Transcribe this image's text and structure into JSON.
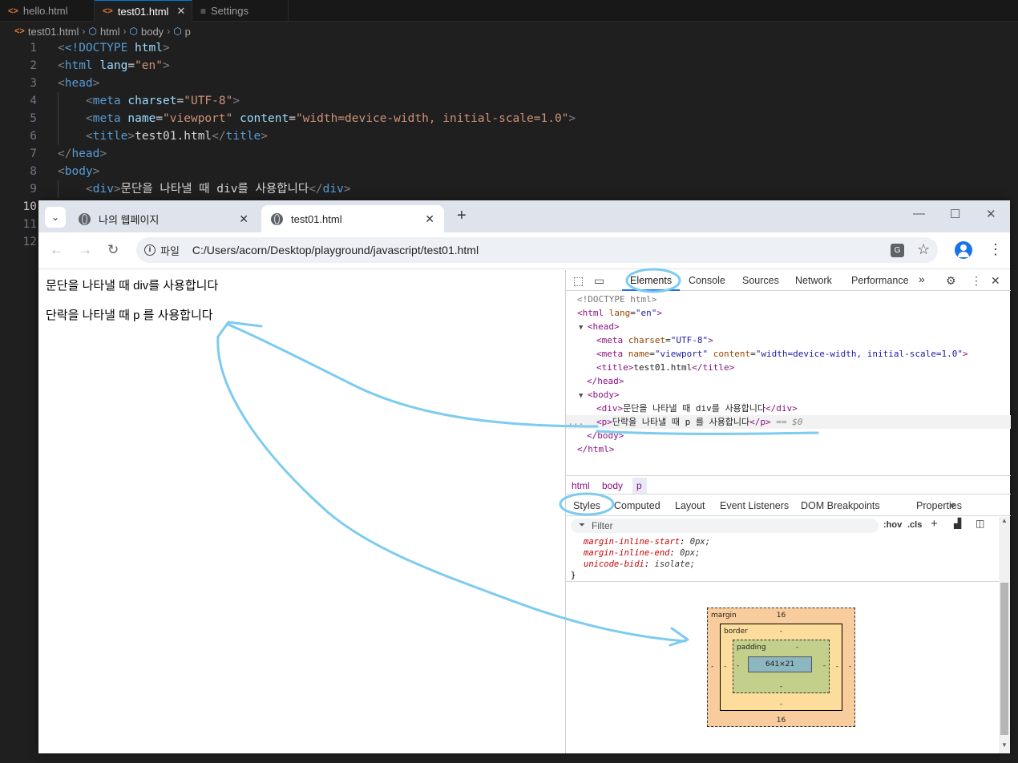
{
  "editor": {
    "tabs": [
      {
        "label": "hello.html",
        "icon": "<>"
      },
      {
        "label": "test01.html",
        "icon": "<>",
        "close": "✕"
      },
      {
        "label": "Settings",
        "icon": "≡"
      }
    ],
    "breadcrumb": [
      "test01.html",
      "html",
      "body",
      "p"
    ],
    "line_numbers": [
      "1",
      "2",
      "3",
      "4",
      "5",
      "6",
      "7",
      "8",
      "9",
      "10",
      "11",
      "12"
    ],
    "code": {
      "l1_a": "<!DOCTYPE ",
      "l1_b": "html",
      "l1_c": ">",
      "l2_tag": "html",
      "l2_attr": "lang",
      "l2_val": "\"en\"",
      "l3_tag": "head",
      "l4_tag": "meta",
      "l4_attr": "charset",
      "l4_val": "\"UTF-8\"",
      "l5_tag": "meta",
      "l5_attr1": "name",
      "l5_val1": "\"viewport\"",
      "l5_attr2": "content",
      "l5_val2": "\"width=device-width, initial-scale=1.0\"",
      "l6_tag": "title",
      "l6_text": "test01.html",
      "l7_tag": "head",
      "l8_tag": "body",
      "l9_tag": "div",
      "l9_text": "문단을 나타낼 때 div를 사용합니다"
    }
  },
  "browser": {
    "tabs": [
      {
        "label": "나의 웹페이지",
        "close": "✕"
      },
      {
        "label": "test01.html",
        "close": "✕"
      }
    ],
    "new_tab": "+",
    "window_controls": {
      "minimize": "—",
      "maximize": "☐",
      "close": "✕"
    },
    "nav": {
      "back": "←",
      "forward": "→",
      "reload": "↻"
    },
    "omnibox": {
      "info": "i",
      "chip": "파일",
      "url": "C:/Users/acorn/Desktop/playground/javascript/test01.html"
    },
    "kebab": "⋮",
    "page": {
      "div_text": "문단을 나타낼 때 div를 사용합니다",
      "p_text": "단락을 나타낼 때 p 를 사용합니다"
    }
  },
  "devtools": {
    "tabs": [
      "Elements",
      "Console",
      "Sources",
      "Network",
      "Performance"
    ],
    "more": "»",
    "close": "✕",
    "kebab": "⋮",
    "tree": {
      "doctype": "<!DOCTYPE html>",
      "html_tag": "html",
      "html_attr": "lang",
      "html_val": "\"en\"",
      "head": "head",
      "meta1_attr": "charset",
      "meta1_val": "\"UTF-8\"",
      "meta2_attr1": "name",
      "meta2_val1": "\"viewport\"",
      "meta2_attr2": "content",
      "meta2_val2": "\"width=device-width, initial-scale=1.0\"",
      "title_text": "test01.html",
      "body": "body",
      "div_text": "문단을 나타낼 때 div를 사용합니다",
      "p_text": "단락을 나타낼 때 p 를 사용합니다",
      "sel_marker": "== $0",
      "ellipsis": "..."
    },
    "crumbs": [
      "html",
      "body",
      "p"
    ],
    "subtabs": [
      "Styles",
      "Computed",
      "Layout",
      "Event Listeners",
      "DOM Breakpoints",
      "Properties"
    ],
    "filter_placeholder": "Filter",
    "filter_tools": {
      "hov": ":hov",
      "cls": ".cls",
      "plus": "+"
    },
    "css": [
      {
        "prop": "margin-inline-start",
        "val": "0px;"
      },
      {
        "prop": "margin-inline-end",
        "val": "0px;"
      },
      {
        "prop": "unicode-bidi",
        "val": "isolate;"
      }
    ],
    "css_close": "}",
    "box_model": {
      "margin_label": "margin",
      "margin_top": "16",
      "margin_bottom": "16",
      "margin_left": "-",
      "margin_right": "-",
      "border_label": "border",
      "border_top": "-",
      "border_bottom": "-",
      "border_left": "-",
      "border_right": "-",
      "padding_label": "padding",
      "padding_top": "-",
      "padding_bottom": "-",
      "padding_left": "-",
      "padding_right": "-",
      "content": "641×21"
    }
  },
  "annotations_color": "#7ccbf0"
}
